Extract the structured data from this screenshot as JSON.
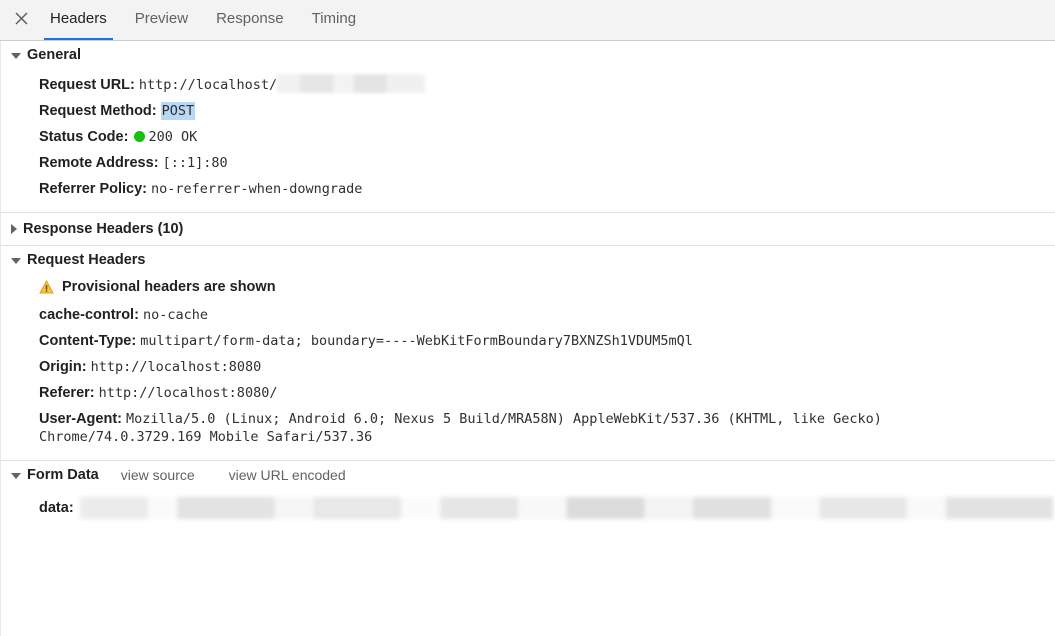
{
  "tabbar": {
    "close_icon": "close-icon",
    "tabs": [
      {
        "label": "Headers",
        "active": true
      },
      {
        "label": "Preview",
        "active": false
      },
      {
        "label": "Response",
        "active": false
      },
      {
        "label": "Timing",
        "active": false
      }
    ]
  },
  "colors": {
    "accent": "#1a73e8",
    "status_ok": "#15c00f",
    "warning": "#e8a33d",
    "selection": "#b9d8f5"
  },
  "general": {
    "title": "General",
    "expanded": true,
    "rows": [
      {
        "key": "Request URL:",
        "value": "http://localhost/",
        "redacted": true
      },
      {
        "key": "Request Method:",
        "value": "POST",
        "selected": true
      },
      {
        "key": "Status Code:",
        "value": "200 OK",
        "status_dot": true
      },
      {
        "key": "Remote Address:",
        "value": "[::1]:80"
      },
      {
        "key": "Referrer Policy:",
        "value": "no-referrer-when-downgrade"
      }
    ]
  },
  "response_headers": {
    "title": "Response Headers (10)",
    "expanded": false
  },
  "request_headers": {
    "title": "Request Headers",
    "expanded": true,
    "warning": "Provisional headers are shown",
    "rows": [
      {
        "key": "cache-control:",
        "value": "no-cache"
      },
      {
        "key": "Content-Type:",
        "value": "multipart/form-data; boundary=----WebKitFormBoundary7BXNZSh1VDUM5mQl"
      },
      {
        "key": "Origin:",
        "value": "http://localhost:8080"
      },
      {
        "key": "Referer:",
        "value": "http://localhost:8080/"
      },
      {
        "key": "User-Agent:",
        "value": "Mozilla/5.0 (Linux; Android 6.0; Nexus 5 Build/MRA58N) AppleWebKit/537.36 (KHTML, like Gecko) Chrome/74.0.3729.169 Mobile Safari/537.36"
      }
    ]
  },
  "form_data": {
    "title": "Form Data",
    "expanded": true,
    "actions": [
      "view source",
      "view URL encoded"
    ],
    "rows": [
      {
        "key": "data:",
        "value": "",
        "redacted": true
      }
    ]
  }
}
